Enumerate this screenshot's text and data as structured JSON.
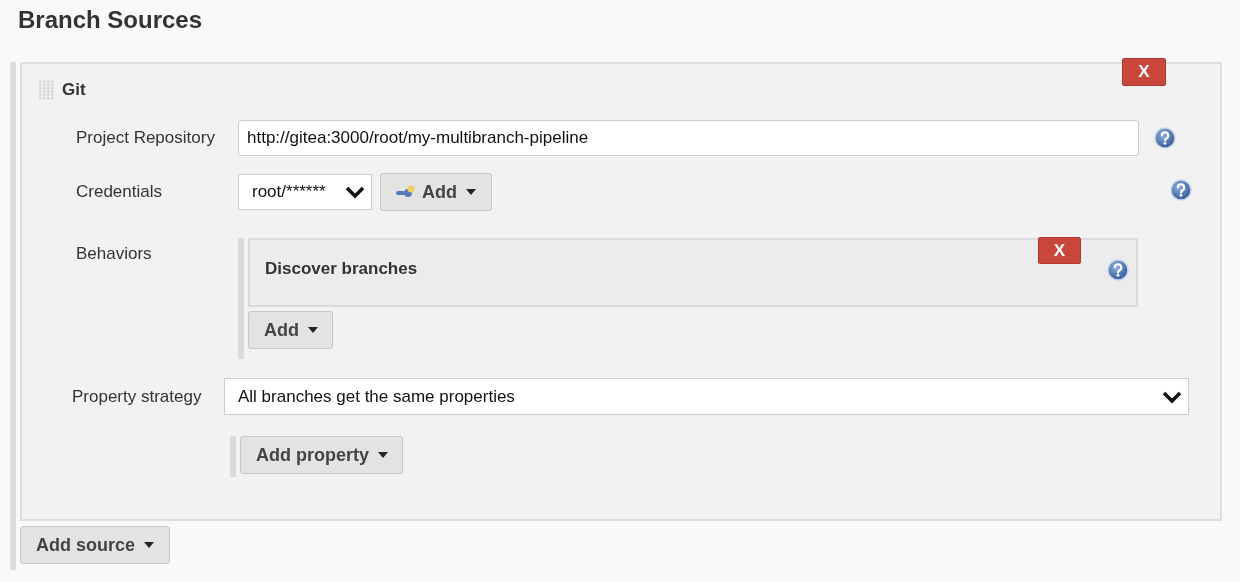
{
  "page_title": "Branch Sources",
  "source": {
    "title": "Git",
    "delete_button": "X",
    "project_repository": {
      "label": "Project Repository",
      "value": "http://gitea:3000/root/my-multibranch-pipeline"
    },
    "credentials": {
      "label": "Credentials",
      "value": "root/******",
      "add_button": "Add"
    },
    "behaviors": {
      "label": "Behaviors",
      "items": [
        {
          "title": "Discover branches",
          "delete_button": "X"
        }
      ],
      "add_button": "Add"
    },
    "property_strategy": {
      "label": "Property strategy",
      "value": "All branches get the same properties"
    },
    "add_property_button": "Add property"
  },
  "add_source_button": "Add source"
}
